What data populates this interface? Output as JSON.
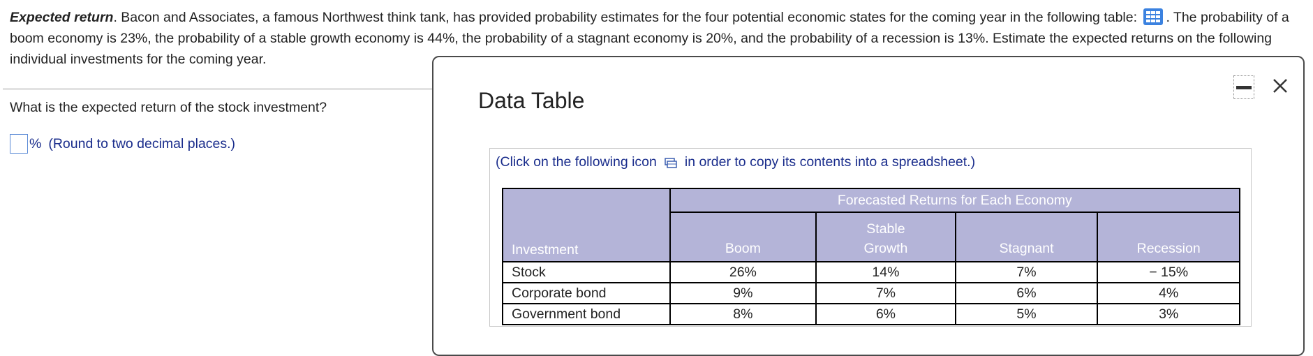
{
  "problem": {
    "bold_title": "Expected return",
    "text_before_icon": ". Bacon and Associates, a famous Northwest think tank, has provided probability estimates for the four potential economic states for the coming year in the following table:",
    "text_after_icon": ". The probability of a boom economy is 23%, the probability of a stable growth economy is 44%, the probability of a stagnant economy is 20%, and the probability of a recession is 13%. Estimate the expected returns on the following individual investments for the coming year."
  },
  "question": {
    "text": "What is the expected return of the stock investment?",
    "unit": "%",
    "hint": "(Round to two decimal places.)",
    "value": ""
  },
  "dialog": {
    "title": "Data Table",
    "note_before": "(Click on the following icon",
    "note_after": "in order to copy its contents into a spreadsheet.)",
    "table": {
      "group_header": "Forecasted Returns for Each Economy",
      "col_investment": "Investment",
      "col_boom": "Boom",
      "col_stable_line1": "Stable",
      "col_stable_line2": "Growth",
      "col_stagnant": "Stagnant",
      "col_recession": "Recession",
      "rows": [
        {
          "name": "Stock",
          "boom": "26%",
          "stable": "14%",
          "stagnant": "7%",
          "recession": "− 15%"
        },
        {
          "name": "Corporate bond",
          "boom": "9%",
          "stable": "7%",
          "stagnant": "6%",
          "recession": "4%"
        },
        {
          "name": "Government bond",
          "boom": "8%",
          "stable": "6%",
          "stagnant": "5%",
          "recession": "3%"
        }
      ]
    }
  },
  "colors": {
    "header_bg": "#b4b4d8",
    "link_blue": "#1a2d8c",
    "icon_blue": "#3b82e0"
  },
  "icons": [
    "table-grid-icon",
    "copy-spreadsheet-icon",
    "minimize-icon",
    "close-icon"
  ]
}
